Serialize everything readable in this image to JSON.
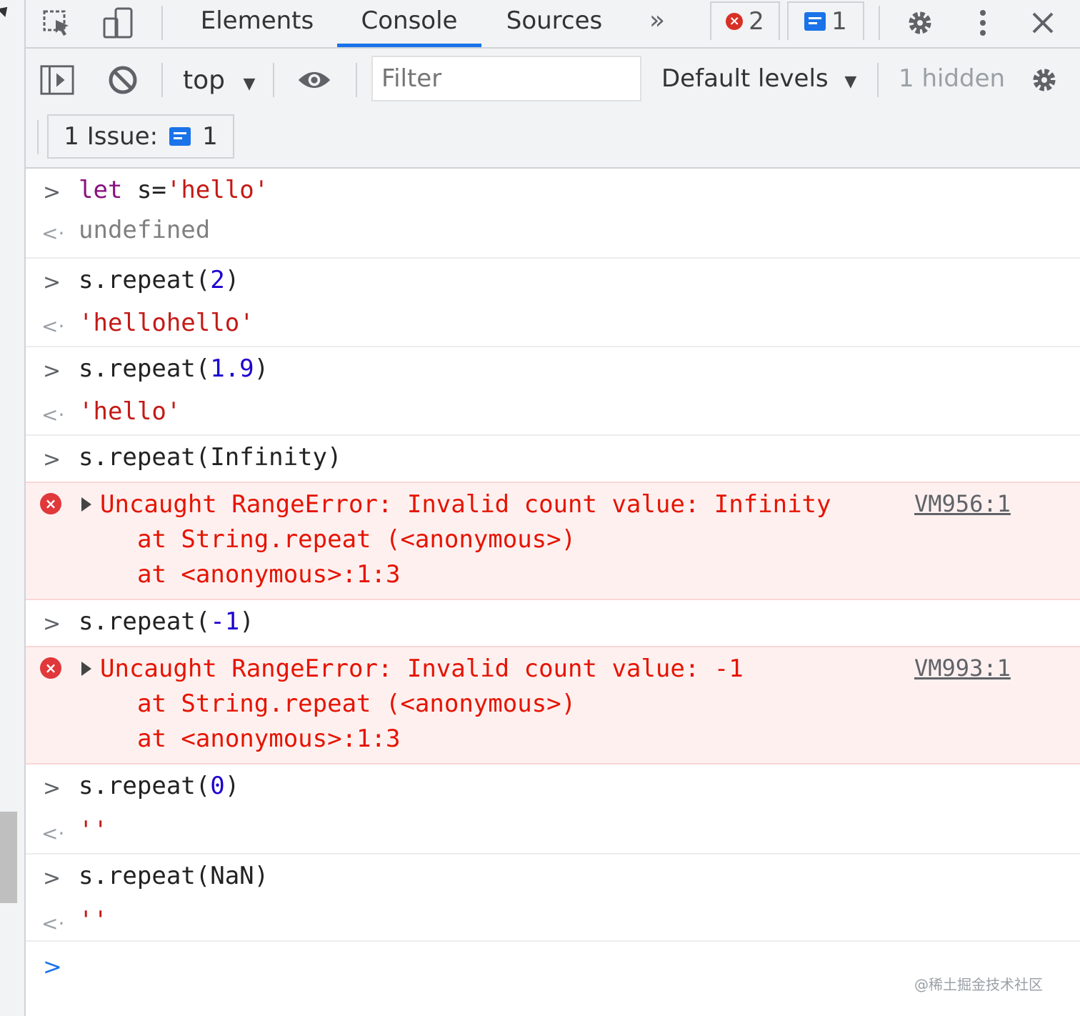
{
  "tabs": [
    {
      "label": "Elements"
    },
    {
      "label": "Console"
    },
    {
      "label": "Sources"
    }
  ],
  "more_tabs": "»",
  "badges": {
    "errors": "2",
    "messages": "1"
  },
  "toolbar": {
    "context": "top",
    "filter_placeholder": "Filter",
    "levels": "Default levels",
    "hidden": "1 hidden"
  },
  "issues": {
    "label": "1 Issue:",
    "count": "1"
  },
  "entries": {
    "e1": {
      "input": {
        "kw": "let",
        "code": " s=",
        "str": "'hello'"
      },
      "result": "undefined"
    },
    "e2": {
      "input": {
        "code": "s.repeat(",
        "num": "2",
        "close": ")"
      },
      "result": "'hellohello'"
    },
    "e3": {
      "input": {
        "code": "s.repeat(",
        "num": "1.9",
        "close": ")"
      },
      "result": "'hello'"
    },
    "e4": {
      "input": {
        "code": "s.repeat(Infinity)"
      }
    },
    "err1": {
      "message": "Uncaught RangeError: Invalid count value: Infinity",
      "stack1": "at String.repeat (<anonymous>)",
      "stack2": "at <anonymous>:1:3",
      "link": "VM956:1"
    },
    "e5": {
      "input": {
        "code": "s.repeat(",
        "num": "-1",
        "close": ")"
      }
    },
    "err2": {
      "message": "Uncaught RangeError: Invalid count value: -1",
      "stack1": "at String.repeat (<anonymous>)",
      "stack2": "at <anonymous>:1:3",
      "link": "VM993:1"
    },
    "e6": {
      "input": {
        "code": "s.repeat(",
        "num": "0",
        "close": ")"
      },
      "result": "''"
    },
    "e7": {
      "input": {
        "code": "s.repeat(NaN)"
      },
      "result": "''"
    }
  },
  "watermark": "@稀土掘金技术社区",
  "icons": {
    "inspect": "inspect-element-icon",
    "device": "device-toolbar-icon",
    "settings": "gear-icon",
    "kebab": "kebab-menu-icon",
    "close": "close-icon",
    "sidebar": "sidebar-toggle-icon",
    "clear": "clear-console-icon",
    "eye": "eye-icon"
  },
  "colors": {
    "accent": "#1a73e8",
    "error": "#e51400",
    "error_bg": "#fff0f0",
    "string": "#c41a16",
    "number": "#1c00cf",
    "keyword": "#881280"
  }
}
